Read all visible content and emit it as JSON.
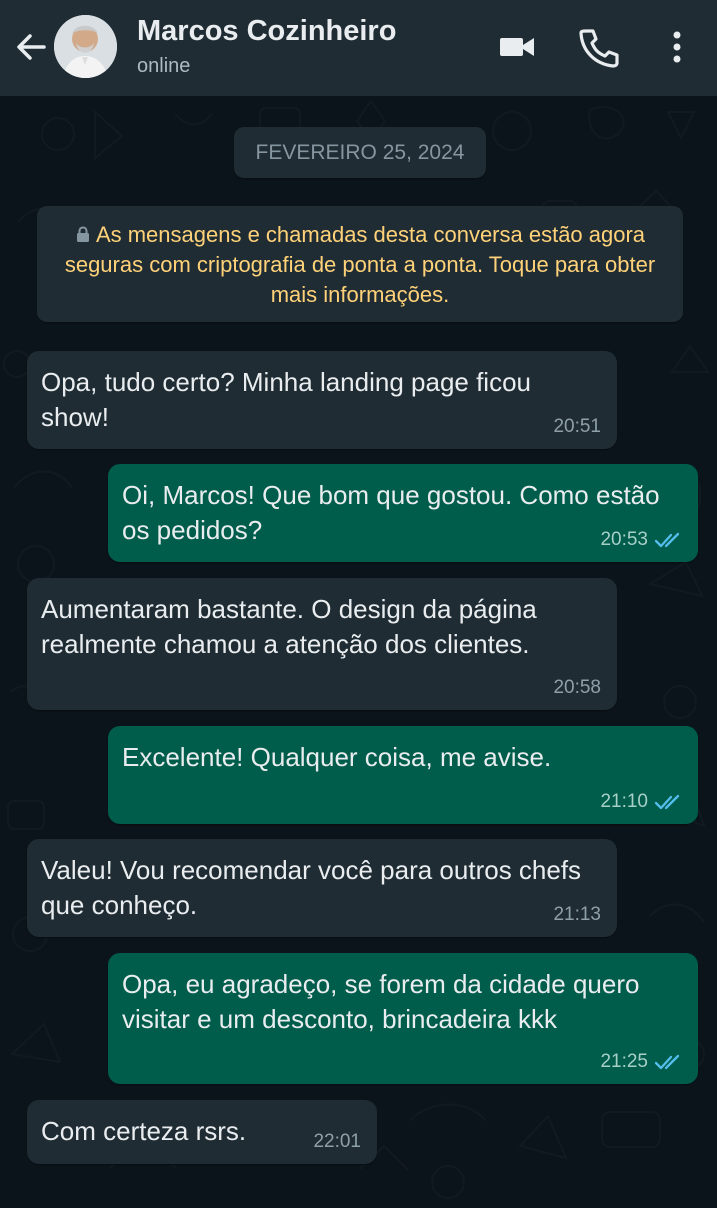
{
  "header": {
    "back_icon": "back-arrow-icon",
    "contact_name": "Marcos Cozinheiro",
    "status": "online",
    "video_icon": "video-call-icon",
    "call_icon": "phone-call-icon",
    "menu_icon": "more-vertical-icon"
  },
  "chat": {
    "date": "FEVEREIRO 25, 2024",
    "encryption_notice": "As mensagens e chamadas desta conversa estão agora seguras com criptografia de ponta a ponta. Toque para obter mais informações.",
    "messages": [
      {
        "direction": "incoming",
        "text": "Opa, tudo certo? Minha landing page ficou show!",
        "time": "20:51"
      },
      {
        "direction": "outgoing",
        "text": "Oi, Marcos! Que bom que gostou. Como estão os pedidos?",
        "time": "20:53",
        "read": true
      },
      {
        "direction": "incoming",
        "text": "Aumentaram bastante. O design da página realmente chamou a atenção dos clientes.",
        "time": "20:58"
      },
      {
        "direction": "outgoing",
        "text": "Excelente! Qualquer coisa, me avise.",
        "time": "21:10",
        "read": true
      },
      {
        "direction": "incoming",
        "text": "Valeu! Vou recomendar você para outros chefs que conheço.",
        "time": "21:13"
      },
      {
        "direction": "outgoing",
        "text": "Opa, eu agradeço, se forem da cidade quero visitar e um desconto, brincadeira kkk",
        "time": "21:25",
        "read": true
      },
      {
        "direction": "incoming",
        "text": "Com certeza rsrs.",
        "time": "22:01"
      }
    ]
  },
  "colors": {
    "header": "#1f2c34",
    "background": "#0b141a",
    "incoming_bubble": "#1f2c33",
    "outgoing_bubble": "#005c4b",
    "encryption_text": "#ffd279",
    "read_ticks": "#53bdeb"
  }
}
